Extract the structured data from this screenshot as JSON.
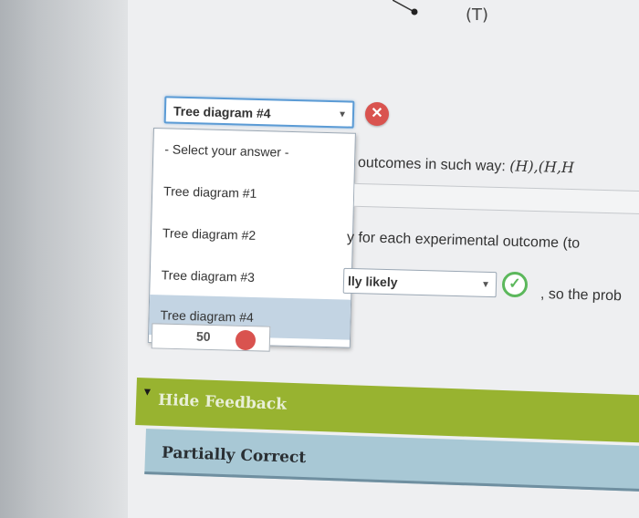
{
  "top_label": "(T)",
  "tree_select": {
    "value": "Tree diagram #4",
    "options": [
      "- Select your answer -",
      "Tree diagram #1",
      "Tree diagram #2",
      "Tree diagram #3",
      "Tree diagram #4"
    ],
    "status_icon": "x-circle-icon",
    "status_color": "#d9534f"
  },
  "sentences": {
    "outcomes_text": "outcomes in such way: ",
    "outcomes_math": "(H),(H,H",
    "probability_text": "y for each experimental outcome (to",
    "trailing_text": ", so the prob"
  },
  "likely_select": {
    "value": "lly likely",
    "status_icon": "check-circle-icon",
    "status_color": "#5cb85c"
  },
  "partial_field": {
    "value": "50"
  },
  "feedback": {
    "toggle_label": "Hide Feedback",
    "bar_color": "#98b330"
  },
  "result": {
    "label": "Partially Correct",
    "bar_color": "#a8c8d5"
  }
}
